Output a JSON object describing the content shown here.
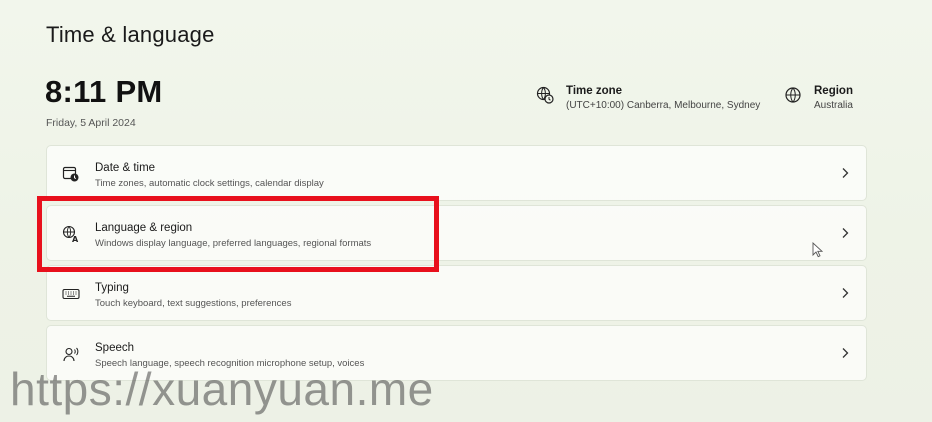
{
  "page": {
    "title": "Time & language"
  },
  "clock": {
    "time": "8:11 PM",
    "date": "Friday, 5 April 2024"
  },
  "info": {
    "timezone": {
      "label": "Time zone",
      "value": "(UTC+10:00) Canberra, Melbourne, Sydney",
      "icon": "globe-clock-icon"
    },
    "region": {
      "label": "Region",
      "value": "Australia",
      "icon": "globe-icon"
    }
  },
  "cards": [
    {
      "title": "Date & time",
      "subtitle": "Time zones, automatic clock settings, calendar display",
      "icon": "calendar-clock-icon"
    },
    {
      "title": "Language & region",
      "subtitle": "Windows display language, preferred languages, regional formats",
      "icon": "language-icon",
      "highlighted": true
    },
    {
      "title": "Typing",
      "subtitle": "Touch keyboard, text suggestions, preferences",
      "icon": "keyboard-icon"
    },
    {
      "title": "Speech",
      "subtitle": "Speech language, speech recognition microphone setup, voices",
      "icon": "speech-icon"
    }
  ],
  "watermark": {
    "text": "https://xuanyuan.me"
  },
  "colors": {
    "highlight": "#e8101c",
    "background": "#f1f5eb",
    "card": "#fbfcf8"
  }
}
